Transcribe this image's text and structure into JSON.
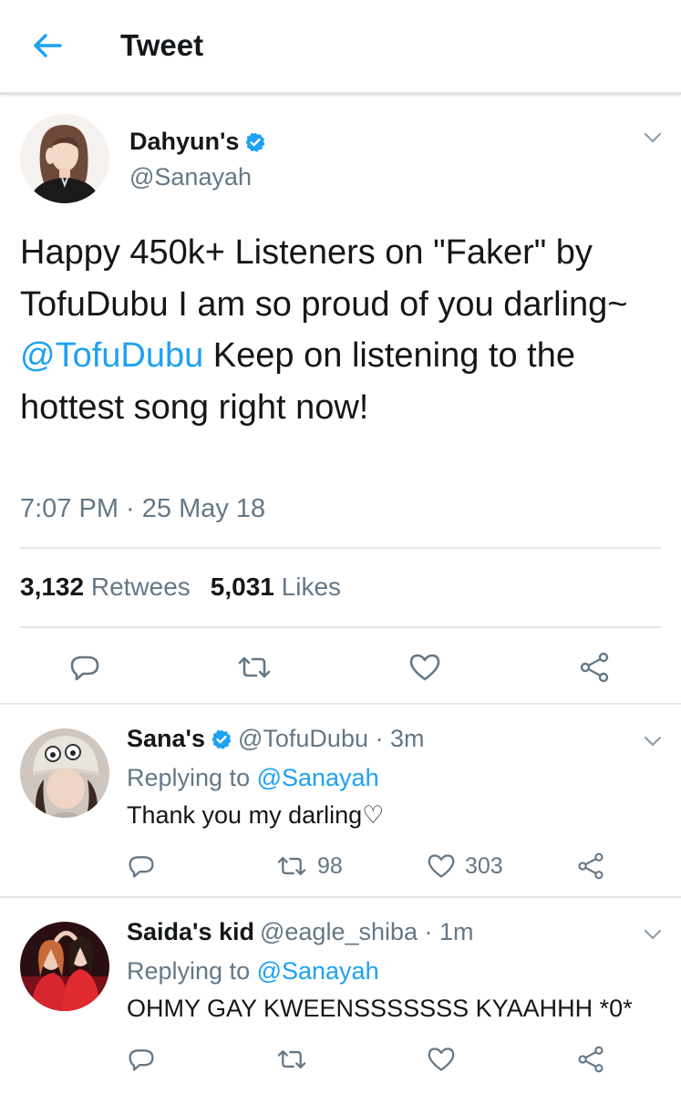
{
  "header": {
    "title": "Tweet",
    "back_icon": "arrow-left-icon",
    "accent": "#1da1f2"
  },
  "main_tweet": {
    "display_name": "Dahyun's",
    "verified": true,
    "handle": "@Sanayah",
    "text_before": "Happy 450k+ Listeners on \"Faker\" by TofuDubu I am so proud of you darling~ ",
    "mention": "@TofuDubu",
    "text_after": " Keep on listening to the hottest song right now!",
    "timestamp": "7:07 PM · 25 May 18",
    "retweets_count": "3,132",
    "retweets_label": "Retwees",
    "likes_count": "5,031",
    "likes_label": "Likes"
  },
  "replies": [
    {
      "display_name": "Sana's",
      "verified": true,
      "meta": "@TofuDubu · 3m",
      "replying_prefix": "Replying to ",
      "replying_handle": "@Sanayah",
      "text": "Thank you my darling♡",
      "retweets": "98",
      "likes": "303"
    },
    {
      "display_name": "Saida's kid",
      "verified": false,
      "meta": "@eagle_shiba · 1m",
      "replying_prefix": "Replying to ",
      "replying_handle": "@Sanayah",
      "text": "OHMY GAY KWEENSSSSSSS KYAAHHH *0*",
      "retweets": "",
      "likes": ""
    }
  ],
  "colors": {
    "text_primary": "#14171a",
    "text_secondary": "#657786",
    "link": "#1da1f2",
    "divider": "#e1e8ed",
    "verified": "#1da1f2"
  }
}
